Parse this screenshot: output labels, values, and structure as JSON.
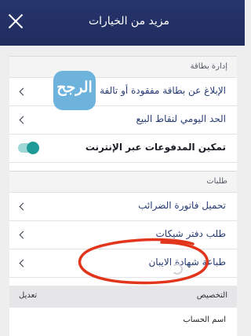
{
  "header": {
    "title": "مزيد من الخيارات"
  },
  "sections": {
    "card_management": {
      "title": "إدارة بطاقة",
      "items": [
        {
          "label": "الإبلاغ عن بطاقة مفقودة أو تالفة"
        },
        {
          "label": "الحد اليومي لنقاط البيع"
        },
        {
          "label": "تمكين المدفوعات عبر الإنترنت",
          "toggle": true
        }
      ]
    },
    "requests": {
      "title": "طلبات",
      "items": [
        {
          "label": "تحميل فاتورة الضرائب"
        },
        {
          "label": "طلب دفتر شيكات"
        },
        {
          "label": "طباعة شهادة الايبان"
        }
      ]
    }
  },
  "customization": {
    "label": "التخصيص",
    "edit_label": "تعديل"
  },
  "account": {
    "label": "اسم الحساب"
  },
  "watermark": {
    "text": "الرجح"
  },
  "colors": {
    "header": "#26356d",
    "toggle_on": "#1e9b97",
    "highlight_circle": "#e2361c",
    "logo": "#6eb3dc"
  }
}
